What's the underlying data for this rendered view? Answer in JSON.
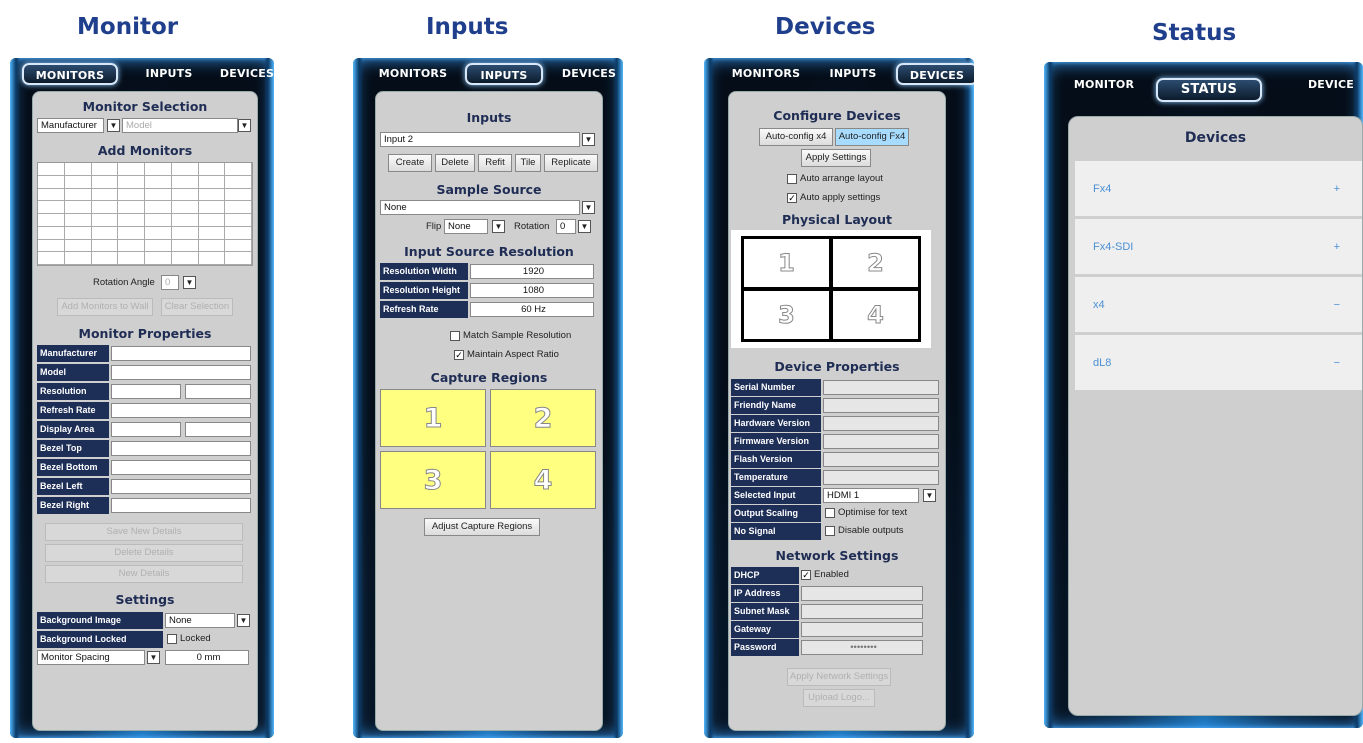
{
  "titles": {
    "monitor": "Monitor",
    "inputs": "Inputs",
    "devices": "Devices",
    "status": "Status"
  },
  "tabs": {
    "monitors": "MONITORS",
    "inputs": "INPUTS",
    "devices": "DEVICES",
    "monitor_short": "MONITOR",
    "status": "STATUS",
    "device_short": "DEVICE"
  },
  "monitor": {
    "sel_title": "Monitor Selection",
    "manufacturer": "Manufacturer",
    "model": "Model",
    "add_title": "Add Monitors",
    "rotation_label": "Rotation Angle",
    "rotation_value": "0",
    "add_btn": "Add Monitors to Wall",
    "clear_btn": "Clear Selection",
    "props_title": "Monitor Properties",
    "props": [
      "Manufacturer",
      "Model",
      "Resolution",
      "Refresh Rate",
      "Display Area",
      "Bezel Top",
      "Bezel Bottom",
      "Bezel Left",
      "Bezel Right"
    ],
    "save_btn": "Save New Details",
    "delete_btn": "Delete Details",
    "new_btn": "New Details",
    "settings_title": "Settings",
    "bg_image_label": "Background Image",
    "bg_image_value": "None",
    "bg_locked_label": "Background Locked",
    "locked": "Locked",
    "spacing_label": "Monitor Spacing",
    "spacing_value": "0 mm"
  },
  "inputs": {
    "title": "Inputs",
    "input_value": "Input 2",
    "buttons": [
      "Create",
      "Delete",
      "Refit",
      "Tile",
      "Replicate"
    ],
    "sample_title": "Sample Source",
    "sample_value": "None",
    "flip_label": "Flip",
    "flip_value": "None",
    "rotation_label": "Rotation",
    "rotation_value": "0",
    "res_title": "Input Source Resolution",
    "res_rows": [
      {
        "label": "Resolution Width",
        "value": "1920"
      },
      {
        "label": "Resolution Height",
        "value": "1080"
      },
      {
        "label": "Refresh Rate",
        "value": "60 Hz"
      }
    ],
    "match": "Match Sample Resolution",
    "aspect": "Maintain Aspect Ratio",
    "capture_title": "Capture Regions",
    "regions": [
      "1",
      "2",
      "3",
      "4"
    ],
    "adjust_btn": "Adjust Capture Regions",
    "region_color": "#ffff80"
  },
  "devices": {
    "config_title": "Configure Devices",
    "autocfg_x4": "Auto-config x4",
    "autocfg_fx4": "Auto-config Fx4",
    "apply_btn": "Apply Settings",
    "auto_arrange": "Auto arrange layout",
    "auto_apply": "Auto apply settings",
    "layout_title": "Physical Layout",
    "cells": [
      "1",
      "2",
      "3",
      "4"
    ],
    "props_title": "Device Properties",
    "props": [
      "Serial Number",
      "Friendly Name",
      "Hardware Version",
      "Firmware Version",
      "Flash Version",
      "Temperature"
    ],
    "selected_input_label": "Selected Input",
    "selected_input_value": "HDMI 1",
    "output_scaling_label": "Output Scaling",
    "optimise": "Optimise for text",
    "no_signal_label": "No Signal",
    "disable_outputs": "Disable outputs",
    "net_title": "Network Settings",
    "dhcp_label": "DHCP",
    "enabled": "Enabled",
    "net_rows": [
      "IP Address",
      "Subnet Mask",
      "Gateway",
      "Password"
    ],
    "password_value": "••••••••",
    "apply_net_btn": "Apply Network Settings",
    "upload_logo_btn": "Upload Logo..."
  },
  "status": {
    "title": "Devices",
    "items": [
      {
        "name": "Fx4",
        "sign": "+"
      },
      {
        "name": "Fx4-SDI",
        "sign": "+"
      },
      {
        "name": "x4",
        "sign": "−"
      },
      {
        "name": "dL8",
        "sign": "−"
      }
    ]
  },
  "colors": {
    "title_blue": "#1f3f8c",
    "label_navy": "#1d2e57",
    "panel_grey": "#cfcfcf",
    "highlight": "#a8dcff",
    "device_link": "#4a8fd4"
  }
}
